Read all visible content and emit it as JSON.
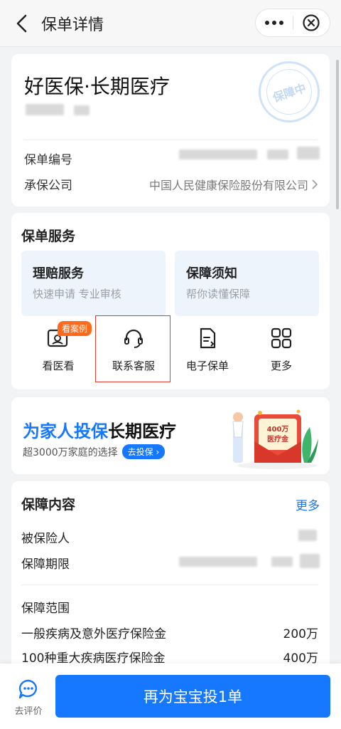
{
  "header": {
    "title": "保单详情"
  },
  "policy": {
    "name": "好医保·长期医疗",
    "seal_text": "保障中",
    "rows": [
      {
        "label": "保单编号",
        "value": ""
      },
      {
        "label": "承保公司",
        "value": "中国人民健康保险股份有限公司"
      }
    ]
  },
  "services": {
    "title": "保单服务",
    "tiles": [
      {
        "title": "理赔服务",
        "subtitle": "快速申请 专业审核"
      },
      {
        "title": "保障须知",
        "subtitle": "帮你读懂保障"
      }
    ],
    "icons": [
      {
        "label": "看医看",
        "badge": "看案例"
      },
      {
        "label": "联系客服"
      },
      {
        "label": "电子保单"
      },
      {
        "label": "更多"
      }
    ]
  },
  "banner": {
    "title_highlight": "为家人投保",
    "title_rest": "长期医疗",
    "subtitle": "超3000万家庭的选择",
    "button": "去投保",
    "art_line1": "400万",
    "art_line2": "医疗金"
  },
  "coverage": {
    "title": "保障内容",
    "more": "更多",
    "rows": [
      {
        "label": "被保险人",
        "value": ""
      },
      {
        "label": "保障期限",
        "value": ""
      }
    ],
    "scope_title": "保障范围",
    "scope": [
      {
        "label": "一般疾病及意外医疗保险金",
        "value": "200万"
      },
      {
        "label": "100种重大疾病医疗保险金",
        "value": "400万"
      }
    ]
  },
  "bottom": {
    "review_label": "去评价",
    "cta_label": "再为宝宝投1单"
  },
  "colors": {
    "primary": "#1677ff",
    "badge": "#ff6a1a",
    "highlight_border": "#e23a2e"
  }
}
